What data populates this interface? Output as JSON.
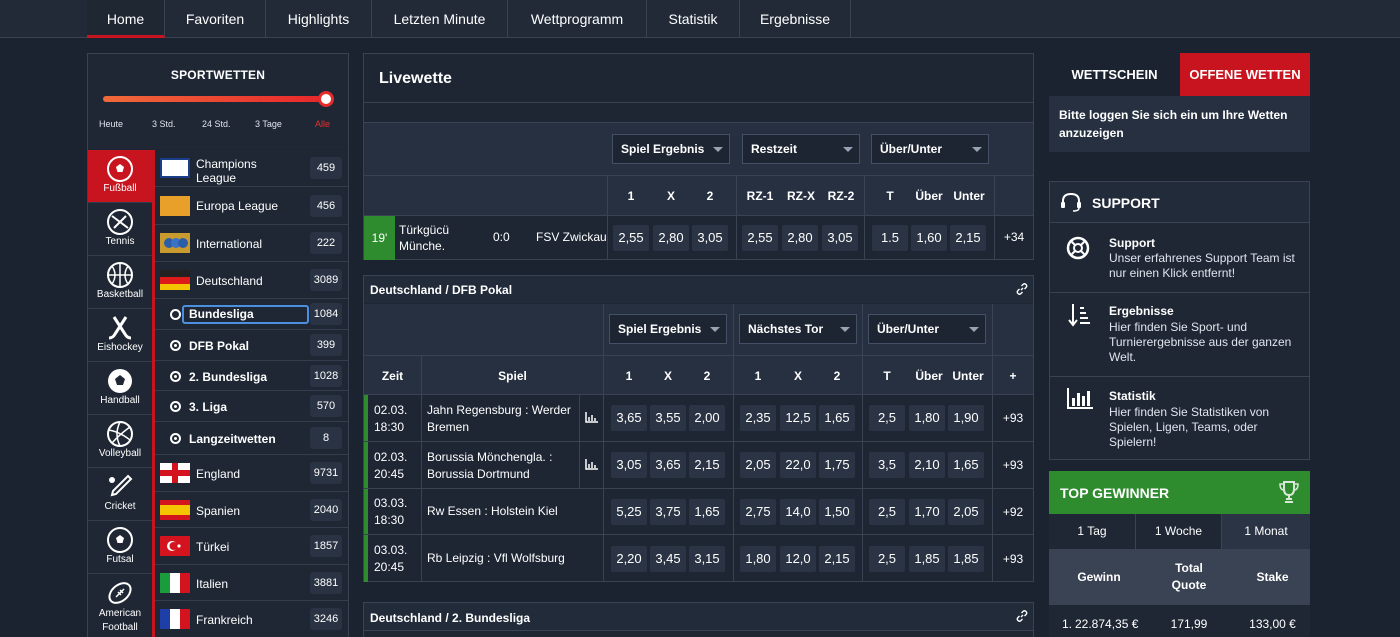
{
  "nav": {
    "items": [
      "Home",
      "Favoriten",
      "Highlights",
      "Letzten Minute",
      "Wettprogramm",
      "Statistik",
      "Ergebnisse"
    ],
    "active": "Home"
  },
  "sportwetten": {
    "title": "SPORTWETTEN",
    "slider_labels": [
      "Heute",
      "3 Std.",
      "24 Std.",
      "3 Tage",
      "Alle"
    ],
    "selected": "Alle"
  },
  "sports": [
    {
      "label": "Fußball",
      "icon": "football-icon",
      "active": true
    },
    {
      "label": "Tennis",
      "icon": "tennis-icon"
    },
    {
      "label": "Basketball",
      "icon": "basketball-icon"
    },
    {
      "label": "Eishockey",
      "icon": "hockey-icon"
    },
    {
      "label": "Handball",
      "icon": "handball-icon"
    },
    {
      "label": "Volleyball",
      "icon": "volleyball-icon"
    },
    {
      "label": "Cricket",
      "icon": "cricket-icon"
    },
    {
      "label": "Futsal",
      "icon": "futsal-icon"
    },
    {
      "label": "American Football",
      "icon": "american-football-icon"
    }
  ],
  "leagues": [
    {
      "name": "Champions League",
      "count": "459",
      "flag": "champions-league-logo"
    },
    {
      "name": "Europa League",
      "count": "456",
      "flag": "europa-league-logo"
    },
    {
      "name": "International",
      "count": "222",
      "flag": "international-icon"
    },
    {
      "name": "Deutschland",
      "count": "3089",
      "flag": "germany-flag"
    },
    {
      "name": "Bundesliga",
      "count": "1084",
      "sub": true,
      "radio": false,
      "focused": true
    },
    {
      "name": "DFB Pokal",
      "count": "399",
      "sub": true,
      "radio": true
    },
    {
      "name": "2. Bundesliga",
      "count": "1028",
      "sub": true,
      "radio": true
    },
    {
      "name": "3. Liga",
      "count": "570",
      "sub": true,
      "radio": true
    },
    {
      "name": "Langzeitwetten",
      "count": "8",
      "sub": true,
      "radio": true
    },
    {
      "name": "England",
      "count": "9731",
      "flag": "england-flag"
    },
    {
      "name": "Spanien",
      "count": "2040",
      "flag": "spain-flag"
    },
    {
      "name": "Türkei",
      "count": "1857",
      "flag": "turkey-flag"
    },
    {
      "name": "Italien",
      "count": "3881",
      "flag": "italy-flag"
    },
    {
      "name": "Frankreich",
      "count": "3246",
      "flag": "france-flag"
    }
  ],
  "live": {
    "title": "Livewette",
    "selects": [
      "Spiel Ergebnis",
      "Restzeit",
      "Über/Unter"
    ],
    "cols": [
      "1",
      "X",
      "2",
      "RZ-1",
      "RZ-X",
      "RZ-2",
      "T",
      "Über",
      "Unter"
    ],
    "match": {
      "minute": "19'",
      "home": "Türkgücü Münche.",
      "score": "0:0",
      "away": "FSV Zwickau",
      "odds": [
        "2,55",
        "2,80",
        "3,05",
        "2,55",
        "2,80",
        "3,05",
        "1.5",
        "1,60",
        "2,15"
      ],
      "more": "+34"
    }
  },
  "pokal": {
    "title": "Deutschland / DFB Pokal",
    "selects": [
      "Spiel Ergebnis",
      "Nächstes Tor",
      "Über/Unter"
    ],
    "col_zeit": "Zeit",
    "col_spiel": "Spiel",
    "cols": [
      "1",
      "X",
      "2",
      "1",
      "X",
      "2",
      "T",
      "Über",
      "Unter",
      "+"
    ],
    "rows": [
      {
        "date": "02.03.",
        "time": "18:30",
        "match": "Jahn Regensburg : Werder Bremen",
        "stats": true,
        "odds": [
          "3,65",
          "3,55",
          "2,00",
          "2,35",
          "12,5",
          "1,65",
          "2,5",
          "1,80",
          "1,90"
        ],
        "more": "+93"
      },
      {
        "date": "02.03.",
        "time": "20:45",
        "match": "Borussia Mönchengla. : Borussia Dortmund",
        "stats": true,
        "odds": [
          "3,05",
          "3,65",
          "2,15",
          "2,05",
          "22,0",
          "1,75",
          "3,5",
          "2,10",
          "1,65"
        ],
        "more": "+93"
      },
      {
        "date": "03.03.",
        "time": "18:30",
        "match": "Rw Essen : Holstein Kiel",
        "stats": false,
        "odds": [
          "5,25",
          "3,75",
          "1,65",
          "2,75",
          "14,0",
          "1,50",
          "2,5",
          "1,70",
          "2,05"
        ],
        "more": "+92"
      },
      {
        "date": "03.03.",
        "time": "20:45",
        "match": "Rb Leipzig : Vfl Wolfsburg",
        "stats": false,
        "odds": [
          "2,20",
          "3,45",
          "3,15",
          "1,80",
          "12,0",
          "2,15",
          "2,5",
          "1,85",
          "1,85"
        ],
        "more": "+93"
      }
    ]
  },
  "bundesliga2": {
    "title": "Deutschland / 2. Bundesliga"
  },
  "betslip": {
    "tab_slip": "WETTSCHEIN",
    "tab_open": "OFFENE WETTEN",
    "login_msg": "Bitte loggen Sie sich ein um Ihre Wetten anzuzeigen"
  },
  "support": {
    "title": "SUPPORT",
    "items": [
      {
        "title": "Support",
        "text": "Unser erfahrenes Support Team ist nur einen Klick entfernt!",
        "icon": "lifebuoy-icon"
      },
      {
        "title": "Ergebnisse",
        "text": "Hier finden Sie Sport- und Turnierergebnisse aus der ganzen Welt.",
        "icon": "sort-icon"
      },
      {
        "title": "Statistik",
        "text": "Hier finden Sie Statistiken von Spielen, Ligen, Teams, oder Spielern!",
        "icon": "bar-chart-icon"
      }
    ]
  },
  "top_winners": {
    "title": "TOP GEWINNER",
    "tabs": [
      "1 Tag",
      "1 Woche",
      "1 Monat"
    ],
    "active_tab": "1 Monat",
    "headers": [
      "Gewinn",
      "Total Quote",
      "Stake"
    ],
    "rows": [
      {
        "rank": "1.",
        "gewinn": "22.874,35 €",
        "quote": "171,99",
        "stake": "133,00 €"
      }
    ]
  },
  "colors": {
    "accent": "#c8141e",
    "green": "#2e8b2e",
    "bg": "#1b2230"
  }
}
